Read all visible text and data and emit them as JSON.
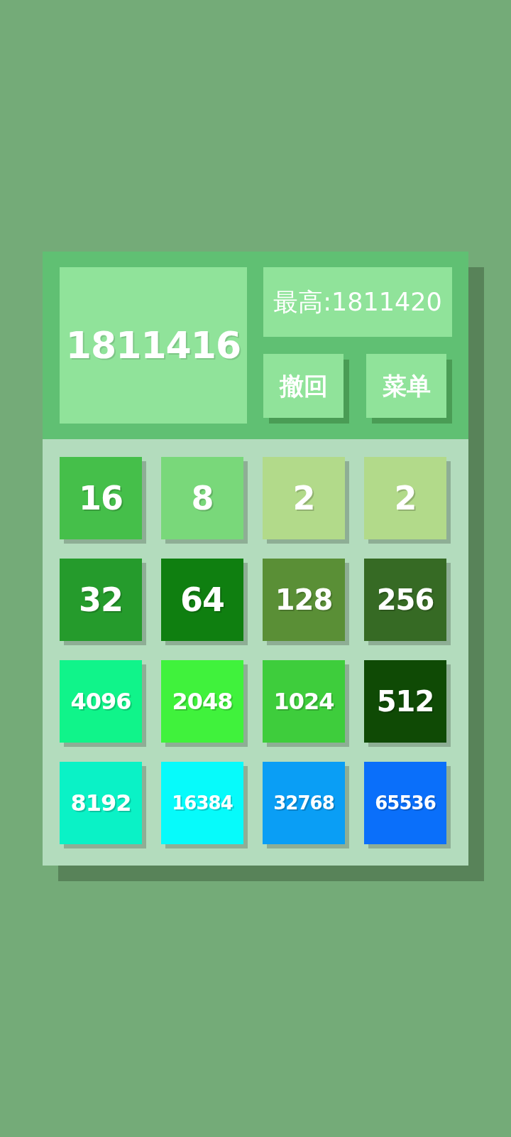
{
  "score": "1811416",
  "best": "最高:1811420",
  "buttons": [
    {
      "label": "撤回"
    },
    {
      "label": "菜单"
    }
  ],
  "board": {
    "rows": [
      [
        {
          "value": "16",
          "color": "#45bf4a"
        },
        {
          "value": "8",
          "color": "#79d87a"
        },
        {
          "value": "2",
          "color": "#b2da8a"
        },
        {
          "value": "2",
          "color": "#b2da8a"
        }
      ],
      [
        {
          "value": "32",
          "color": "#259b2c"
        },
        {
          "value": "64",
          "color": "#0f7f10"
        },
        {
          "value": "128",
          "color": "#5a8f36"
        },
        {
          "value": "256",
          "color": "#366a24"
        }
      ],
      [
        {
          "value": "4096",
          "color": "#10f48a"
        },
        {
          "value": "2048",
          "color": "#40f23c"
        },
        {
          "value": "1024",
          "color": "#3ecd3c"
        },
        {
          "value": "512",
          "color": "#0f4a05"
        }
      ],
      [
        {
          "value": "8192",
          "color": "#0af2c6"
        },
        {
          "value": "16384",
          "color": "#06fbfb"
        },
        {
          "value": "32768",
          "color": "#0a9ef5"
        },
        {
          "value": "65536",
          "color": "#0a6ffa"
        }
      ]
    ]
  }
}
